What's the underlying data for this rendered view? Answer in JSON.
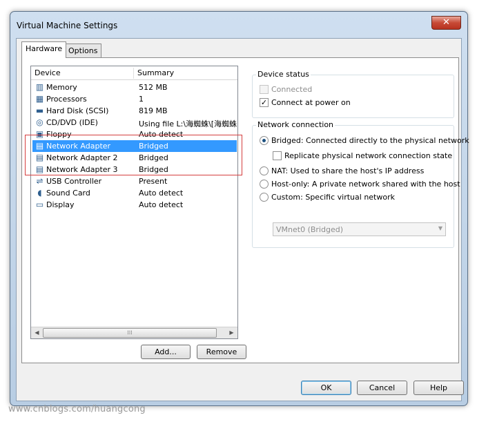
{
  "window": {
    "title": "Virtual Machine Settings",
    "close_glyph": "✕"
  },
  "tabs": [
    {
      "label": "Hardware"
    },
    {
      "label": "Options"
    }
  ],
  "device_list": {
    "columns": {
      "device": "Device",
      "summary": "Summary"
    },
    "items": [
      {
        "icon": "memory-icon",
        "glyph": "▥",
        "name": "Memory",
        "summary": "512 MB"
      },
      {
        "icon": "processor-icon",
        "glyph": "▦",
        "name": "Processors",
        "summary": "1"
      },
      {
        "icon": "hard-disk-icon",
        "glyph": "▬",
        "name": "Hard Disk (SCSI)",
        "summary": "819 MB"
      },
      {
        "icon": "cd-dvd-icon",
        "glyph": "◎",
        "name": "CD/DVD (IDE)",
        "summary": "Using file L:\\海蜘蛛\\[海蜘蛛."
      },
      {
        "icon": "floppy-icon",
        "glyph": "▣",
        "name": "Floppy",
        "summary": "Auto detect"
      },
      {
        "icon": "network-adapter-icon",
        "glyph": "▤",
        "name": "Network Adapter",
        "summary": "Bridged"
      },
      {
        "icon": "network-adapter-icon",
        "glyph": "▤",
        "name": "Network Adapter 2",
        "summary": "Bridged"
      },
      {
        "icon": "network-adapter-icon",
        "glyph": "▤",
        "name": "Network Adapter 3",
        "summary": "Bridged"
      },
      {
        "icon": "usb-icon",
        "glyph": "⇌",
        "name": "USB Controller",
        "summary": "Present"
      },
      {
        "icon": "sound-card-icon",
        "glyph": "◖",
        "name": "Sound Card",
        "summary": "Auto detect"
      },
      {
        "icon": "display-icon",
        "glyph": "▭",
        "name": "Display",
        "summary": "Auto detect"
      }
    ],
    "selected_index": 5,
    "scroll": {
      "left": "◀",
      "thumb": "⁞⁞⁞",
      "right": "▶"
    }
  },
  "buttons": {
    "add": "Add...",
    "remove": "Remove",
    "ok": "OK",
    "cancel": "Cancel",
    "help": "Help"
  },
  "device_status": {
    "label": "Device status",
    "connected": {
      "label": "Connected",
      "checked": false,
      "enabled": false
    },
    "connect_at_power_on": {
      "label": "Connect at power on",
      "checked": true
    }
  },
  "network_connection": {
    "label": "Network connection",
    "options": [
      {
        "label": "Bridged: Connected directly to the physical network",
        "selected": true
      },
      {
        "label": "NAT: Used to share the host's IP address",
        "selected": false
      },
      {
        "label": "Host-only: A private network shared with the host",
        "selected": false
      },
      {
        "label": "Custom: Specific virtual network",
        "selected": false
      }
    ],
    "replicate": {
      "label": "Replicate physical network connection state",
      "checked": false
    },
    "vmnet": {
      "value": "VMnet0 (Bridged)",
      "arrow": "▼"
    }
  },
  "watermark": "www.cnblogs.com/huangcong",
  "colors": {
    "selection": "#3399ff",
    "annotation": "#d43d3d"
  }
}
